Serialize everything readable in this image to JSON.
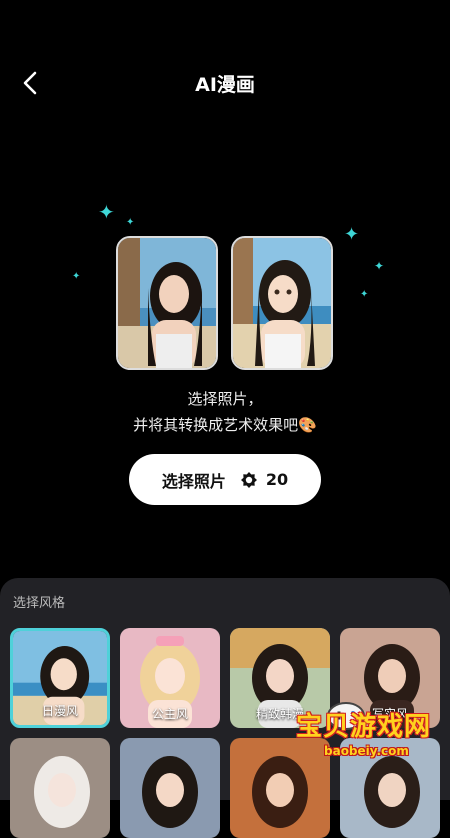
{
  "header": {
    "title": "AI漫画"
  },
  "intro": {
    "line1": "选择照片，",
    "line2": "并将其转换成艺术效果吧🎨"
  },
  "select_button": {
    "label": "选择照片",
    "cost": "20"
  },
  "styles": {
    "title": "选择风格",
    "items": [
      {
        "label": "日漫风",
        "selected": true
      },
      {
        "label": "公主风",
        "selected": false
      },
      {
        "label": "精致韩漫",
        "selected": false
      },
      {
        "label": "写实风",
        "selected": false
      },
      {
        "label": "",
        "selected": false
      },
      {
        "label": "",
        "selected": false
      },
      {
        "label": "",
        "selected": false
      },
      {
        "label": "",
        "selected": false
      }
    ]
  },
  "watermark": {
    "text": "宝贝游戏网",
    "url": "baobeiy.com"
  },
  "colors": {
    "background": "#000000",
    "accent": "#4fd1d9",
    "panel": "#222226"
  }
}
